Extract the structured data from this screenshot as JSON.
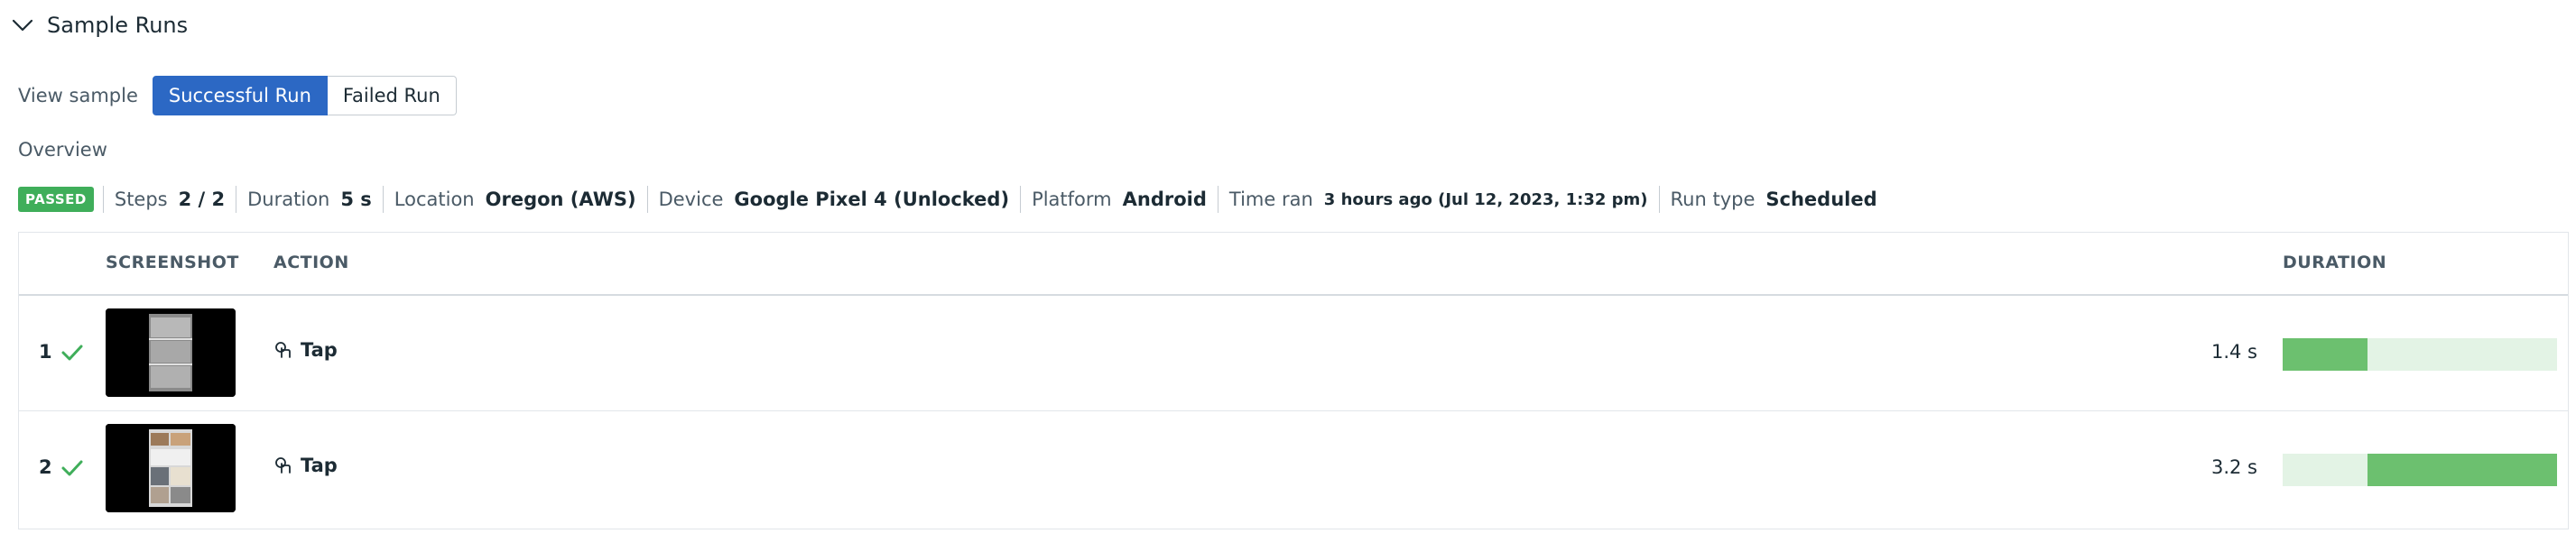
{
  "section": {
    "title": "Sample Runs",
    "icon": "chevron-down-icon"
  },
  "view_sample": {
    "label": "View sample",
    "options": [
      "Successful Run",
      "Failed Run"
    ],
    "selected": "Successful Run"
  },
  "overview": {
    "label": "Overview",
    "status": "PASSED",
    "steps_key": "Steps",
    "steps_val": "2 / 2",
    "duration_key": "Duration",
    "duration_val": "5 s",
    "location_key": "Location",
    "location_val": "Oregon (AWS)",
    "device_key": "Device",
    "device_val": "Google Pixel 4 (Unlocked)",
    "platform_key": "Platform",
    "platform_val": "Android",
    "time_key": "Time ran",
    "time_val": "3 hours ago (Jul 12, 2023, 1:32 pm)",
    "runtype_key": "Run type",
    "runtype_val": "Scheduled"
  },
  "colors": {
    "accent": "#2c68c4",
    "passed": "#3fae5a",
    "bar_fill": "#6cc06f",
    "bar_track": "#e3f3e5"
  },
  "table": {
    "headers": {
      "screenshot": "SCREENSHOT",
      "action": "ACTION",
      "duration": "DURATION"
    },
    "rows": [
      {
        "num": "1",
        "status_icon": "check-icon",
        "action_icon": "tap-icon",
        "action": "Tap",
        "duration": "1.4 s",
        "bar_start": 0,
        "bar_fraction": 0.31
      },
      {
        "num": "2",
        "status_icon": "check-icon",
        "action_icon": "tap-icon",
        "action": "Tap",
        "duration": "3.2 s",
        "bar_start": 0.31,
        "bar_fraction": 0.69
      }
    ]
  }
}
